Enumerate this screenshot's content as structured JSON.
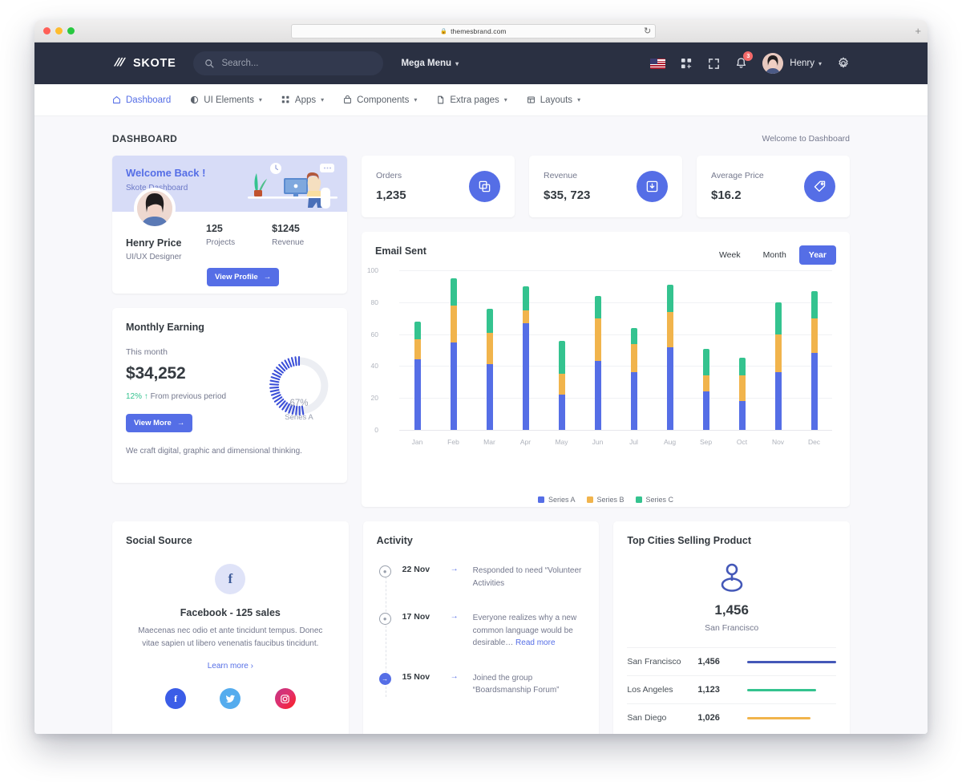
{
  "browser": {
    "url": "themesbrand.com",
    "lock_icon": "lock-icon",
    "reload_icon": "reload-icon",
    "newtab_label": "+"
  },
  "topbar": {
    "brand": "SKOTE",
    "search_placeholder": "Search...",
    "search_value": "",
    "mega_menu": "Mega Menu",
    "notification_count": "3",
    "user_name": "Henry",
    "icons": [
      "flag-us-icon",
      "apps-grid-icon",
      "fullscreen-icon",
      "bell-icon",
      "gear-icon"
    ]
  },
  "nav": {
    "items": [
      {
        "label": "Dashboard",
        "icon": "home-icon",
        "has_caret": false,
        "active": true
      },
      {
        "label": "UI Elements",
        "icon": "contrast-icon",
        "has_caret": true,
        "active": false
      },
      {
        "label": "Apps",
        "icon": "grid-icon",
        "has_caret": true,
        "active": false
      },
      {
        "label": "Components",
        "icon": "box-icon",
        "has_caret": true,
        "active": false
      },
      {
        "label": "Extra pages",
        "icon": "file-icon",
        "has_caret": true,
        "active": false
      },
      {
        "label": "Layouts",
        "icon": "layout-icon",
        "has_caret": true,
        "active": false
      }
    ]
  },
  "page": {
    "title": "DASHBOARD",
    "breadcrumb": "Welcome to Dashboard"
  },
  "welcome_card": {
    "title": "Welcome Back !",
    "subtitle": "Skote Dashboard",
    "name": "Henry Price",
    "role": "UI/UX Designer",
    "stats": [
      {
        "value": "125",
        "label": "Projects"
      },
      {
        "value": "$1245",
        "label": "Revenue"
      }
    ],
    "button": "View Profile"
  },
  "monthly_earning": {
    "title": "Monthly Earning",
    "period_label": "This month",
    "amount": "$34,252",
    "delta": "12%",
    "delta_text": "From previous period",
    "button": "View More",
    "footer": "We craft digital, graphic and dimensional thinking.",
    "gauge_percent": "67%",
    "gauge_series": "Series A",
    "gauge_value": 67
  },
  "stat_cards": [
    {
      "label": "Orders",
      "value": "1,235",
      "icon": "copy-icon"
    },
    {
      "label": "Revenue",
      "value": "$35, 723",
      "icon": "archive-download-icon"
    },
    {
      "label": "Average Price",
      "value": "$16.2",
      "icon": "price-tag-icon"
    }
  ],
  "chart_data": {
    "type": "bar",
    "title": "Email Sent",
    "stacked": true,
    "categories": [
      "Jan",
      "Feb",
      "Mar",
      "Apr",
      "May",
      "Jun",
      "Jul",
      "Aug",
      "Sep",
      "Oct",
      "Nov",
      "Dec"
    ],
    "series": [
      {
        "name": "Series A",
        "color": "#556ee6",
        "values": [
          44,
          55,
          41,
          67,
          22,
          43,
          36,
          52,
          24,
          18,
          36,
          48
        ]
      },
      {
        "name": "Series B",
        "color": "#f1b44c",
        "values": [
          13,
          23,
          20,
          8,
          13,
          27,
          18,
          22,
          10,
          16,
          24,
          22
        ]
      },
      {
        "name": "Series C",
        "color": "#34c38f",
        "values": [
          11,
          17,
          15,
          15,
          21,
          14,
          10,
          17,
          17,
          11,
          20,
          17
        ]
      }
    ],
    "yticks": [
      0,
      20,
      40,
      60,
      80,
      100
    ],
    "ylim": [
      0,
      100
    ],
    "xlabel": "",
    "ylabel": "",
    "grid": true,
    "legend_position": "bottom",
    "toggles": [
      {
        "label": "Week",
        "active": false
      },
      {
        "label": "Month",
        "active": false
      },
      {
        "label": "Year",
        "active": true
      }
    ]
  },
  "social_source": {
    "title": "Social Source",
    "icon": "facebook-icon",
    "headline": "Facebook - 125 sales",
    "description": "Maecenas nec odio et ante tincidunt tempus. Donec vitae sapien ut libero venenatis faucibus tincidunt.",
    "learn_more": "Learn more",
    "buttons": [
      "facebook-icon",
      "twitter-icon",
      "instagram-icon"
    ]
  },
  "activity": {
    "title": "Activity",
    "items": [
      {
        "date": "22 Nov",
        "text": "Responded to need “Volunteer Activities",
        "read_more": "",
        "active": false
      },
      {
        "date": "17 Nov",
        "text": "Everyone realizes why a new common language would be desirable… ",
        "read_more": "Read more",
        "active": false
      },
      {
        "date": "15 Nov",
        "text": "Joined the group “Boardsmanship Forum”",
        "read_more": "",
        "active": true
      }
    ]
  },
  "top_cities": {
    "title": "Top Cities Selling Product",
    "icon": "map-pin-icon",
    "featured_value": "1,456",
    "featured_city": "San Francisco",
    "rows": [
      {
        "city": "San Francisco",
        "value": "1,456",
        "bar_percent": 100,
        "color": "#4458b8"
      },
      {
        "city": "Los Angeles",
        "value": "1,123",
        "bar_percent": 77,
        "color": "#34c38f"
      },
      {
        "city": "San Diego",
        "value": "1,026",
        "bar_percent": 71,
        "color": "#f1b44c"
      }
    ]
  },
  "colors": {
    "primary": "#556ee6",
    "warning": "#f1b44c",
    "success": "#34c38f",
    "danger": "#f46a6a",
    "dark_header": "#2a3042",
    "page_bg": "#f8f8fb"
  }
}
